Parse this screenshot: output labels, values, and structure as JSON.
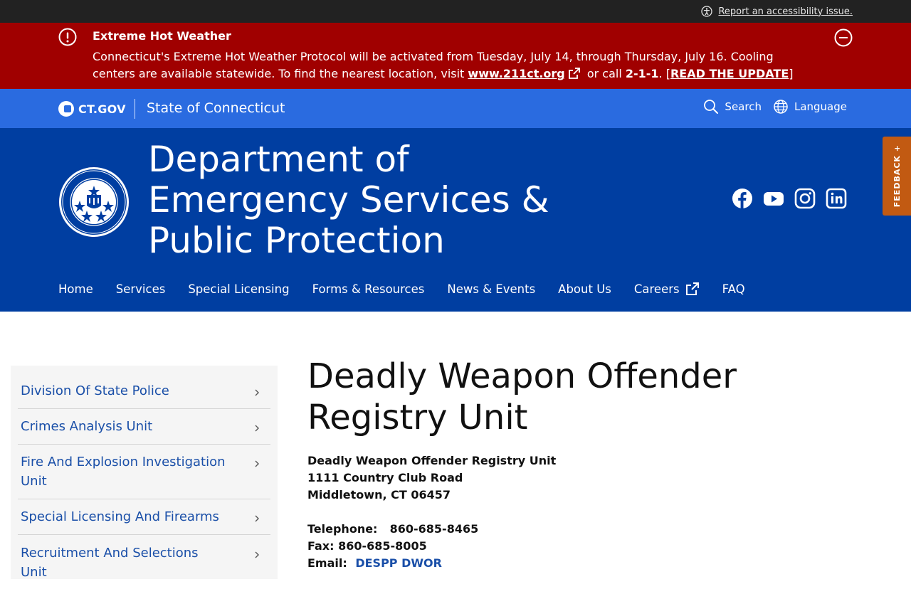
{
  "utility": {
    "accessibility_link": "Report an accessibility issue."
  },
  "alert": {
    "title": "Extreme Hot Weather",
    "body_part1": "Connecticut's Extreme Hot Weather Protocol will be activated from Tuesday, July 14, through Thursday, July 16. Cooling centers are available statewide. To find the nearest location, visit ",
    "link_text": "www.211ct.org",
    "body_part2": " or call ",
    "phone": "2-1-1",
    "body_part3": ". [",
    "update_link": "READ THE UPDATE",
    "body_part4": "]"
  },
  "ctbar": {
    "logo_text": "CT.GOV",
    "state_name": "State of Connecticut",
    "search_label": "Search",
    "language_label": "Language"
  },
  "agency": {
    "title_line1": "Department of",
    "title_line2": "Emergency Services &",
    "title_line3": "Public Protection",
    "social": [
      "facebook-icon",
      "youtube-icon",
      "instagram-icon",
      "linkedin-icon"
    ]
  },
  "nav": {
    "items": [
      "Home",
      "Services",
      "Special Licensing",
      "Forms & Resources",
      "News & Events",
      "About Us",
      "Careers",
      "FAQ"
    ]
  },
  "feedback": {
    "label": "FEEDBACK +"
  },
  "sidebar": {
    "items": [
      "Division Of State Police",
      "Crimes Analysis Unit",
      "Fire And Explosion Investigation Unit",
      "Special Licensing And Firearms",
      "Recruitment And Selections Unit"
    ]
  },
  "main": {
    "title": "Deadly Weapon Offender Registry Unit",
    "address_name": "Deadly Weapon Offender Registry Unit",
    "address_street": "1111 Country Club Road",
    "address_city": "Middletown, CT 06457",
    "telephone_label": "Telephone:",
    "telephone": "860-685-8465",
    "fax_label": "Fax:",
    "fax": "860-685-8005",
    "email_label": "Email:",
    "email_link": "DESPP DWOR"
  },
  "colors": {
    "alert_red": "#a00000",
    "ctbar_blue": "#2a6be0",
    "agency_blue": "#003ea1",
    "feedback_orange": "#c25a12",
    "link_blue": "#1a4fa8"
  }
}
